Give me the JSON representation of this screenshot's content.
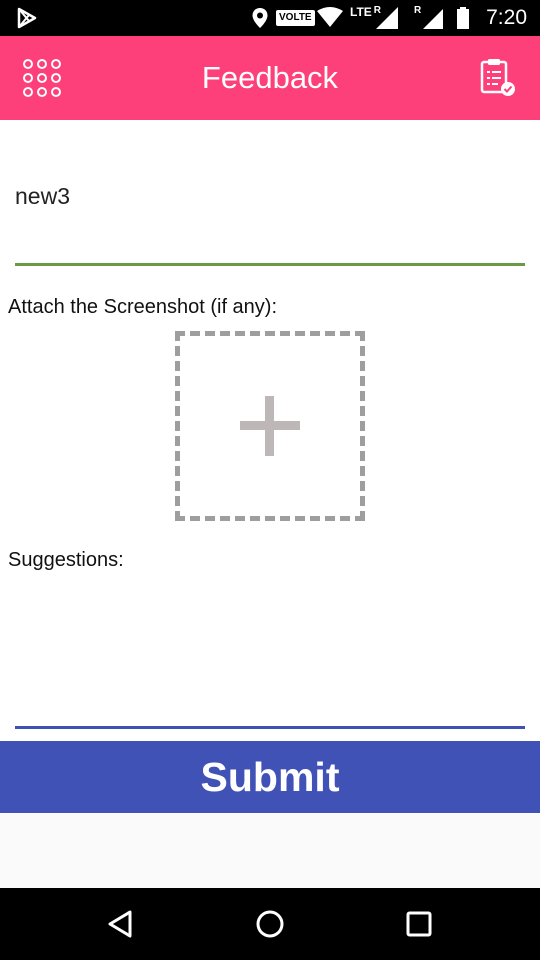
{
  "status_bar": {
    "time": "7:20",
    "icons": [
      "play-store-icon",
      "location-icon",
      "volte-icon",
      "wifi-icon",
      "lte-signal-icon",
      "signal-roaming-icon",
      "battery-icon"
    ],
    "volte_label": "VOLTE",
    "lte_label": "LTE",
    "roaming_label": "R"
  },
  "app_bar": {
    "title": "Feedback",
    "menu_icon": "grid-dots-icon",
    "action_icon": "clipboard-check-icon",
    "background": "#fd3f7a"
  },
  "form": {
    "title_value": "new3",
    "attach_label": "Attach the Screenshot (if any):",
    "attach_icon": "plus-icon",
    "suggestions_label": "Suggestions:",
    "suggestions_value": "",
    "title_underline_color": "#6a9a46",
    "suggestions_underline_color": "#4051b5"
  },
  "submit": {
    "label": "Submit",
    "background": "#4152b6"
  },
  "nav_bar": {
    "icons": [
      "back-icon",
      "home-icon",
      "recents-icon"
    ]
  }
}
